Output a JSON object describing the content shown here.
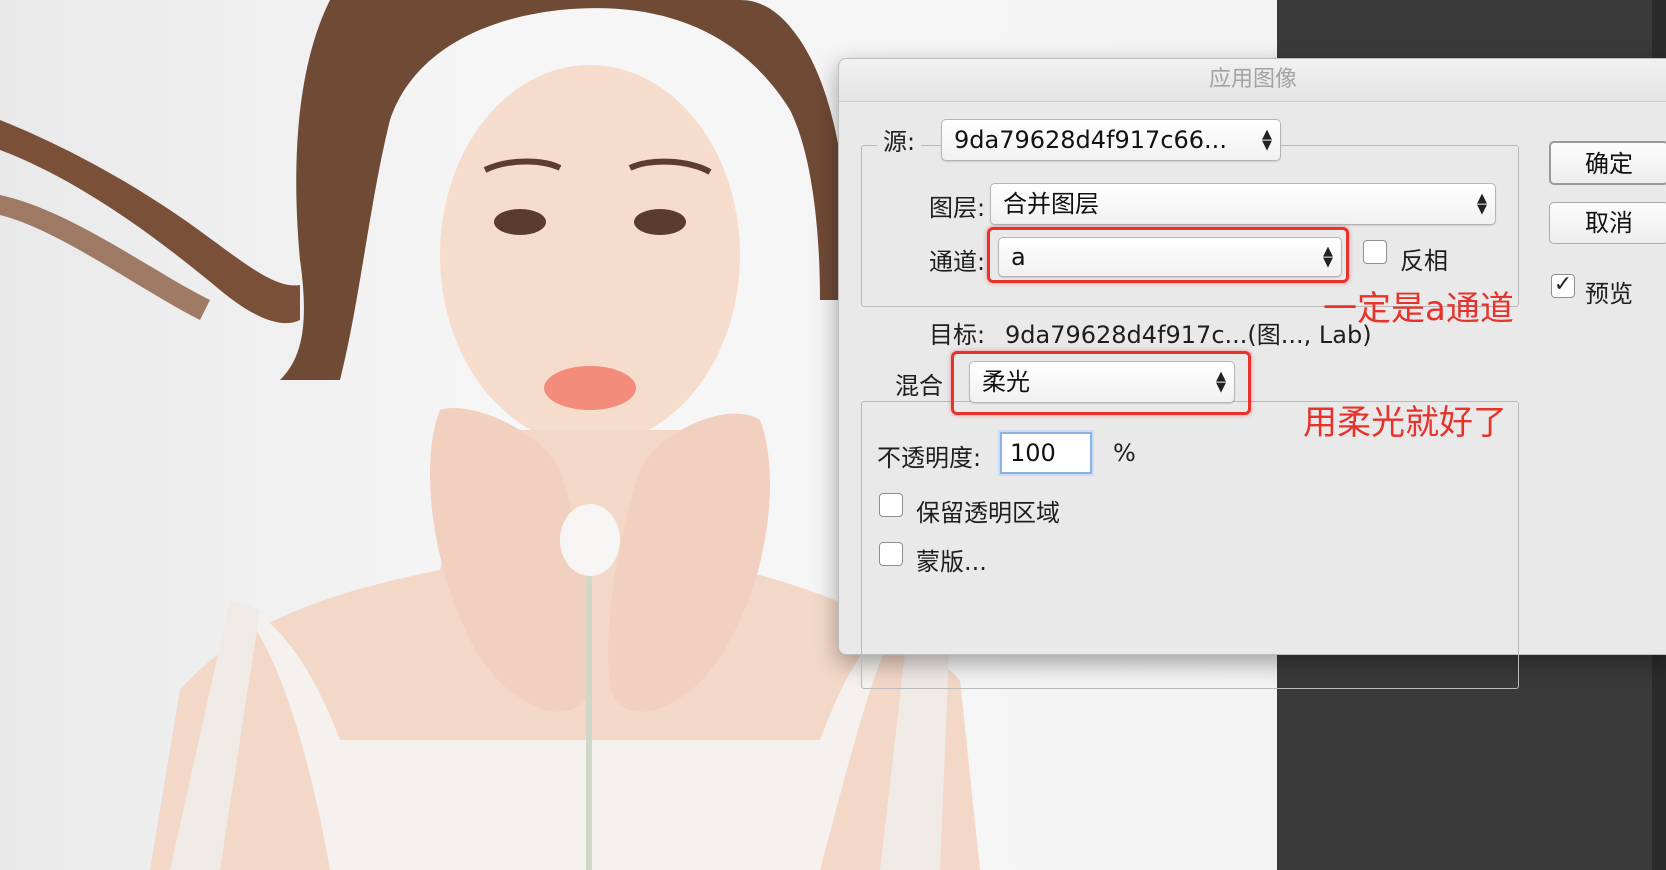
{
  "dialog": {
    "title": "应用图像",
    "source": {
      "label": "源:",
      "value": "9da79628d4f917c66..."
    },
    "layer": {
      "label": "图层:",
      "value": "合并图层"
    },
    "channel": {
      "label": "通道:",
      "value": "a",
      "invert_label": "反相",
      "invert_checked": false
    },
    "target": {
      "label": "目标:",
      "value": "9da79628d4f917c...(图..., Lab)"
    },
    "blending": {
      "label": "混合",
      "value": "柔光"
    },
    "opacity": {
      "label": "不透明度:",
      "value": "100",
      "unit": "%"
    },
    "preserve_transparency": {
      "label": "保留透明区域",
      "checked": false
    },
    "mask": {
      "label": "蒙版...",
      "checked": false
    },
    "buttons": {
      "ok": "确定",
      "cancel": "取消"
    },
    "preview": {
      "label": "预览",
      "checked": true
    }
  },
  "annotations": {
    "channel_note": "一定是a通道",
    "blend_note": "用柔光就好了"
  },
  "colors": {
    "annotation": "#e8322c",
    "dialog_bg": "#e9e9e9",
    "dark_panel": "#3a3a3a"
  },
  "icons": {
    "select_arrow": "updown-chevron-icon",
    "check": "checkmark-icon"
  }
}
